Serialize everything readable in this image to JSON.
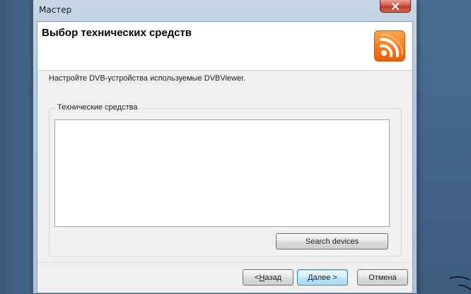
{
  "window": {
    "title": "Мастер"
  },
  "header": {
    "title": "Выбор технических средств",
    "logo_icon": "dvbviewer-logo-icon"
  },
  "instruction": "Настройте DVB-устройства используемые DVBViewer.",
  "group": {
    "label": "Технические средства",
    "devices": []
  },
  "buttons": {
    "search": "Search devices",
    "back_arrow": "< ",
    "back_mnemonic": "Н",
    "back_rest": "азад",
    "next_mnemonic": "Д",
    "next_rest": "алее >",
    "cancel": "Отмена"
  },
  "colors": {
    "logo_orange": "#ff7a1a",
    "close_red": "#c0392b",
    "default_button_border": "#3c7fb1"
  }
}
